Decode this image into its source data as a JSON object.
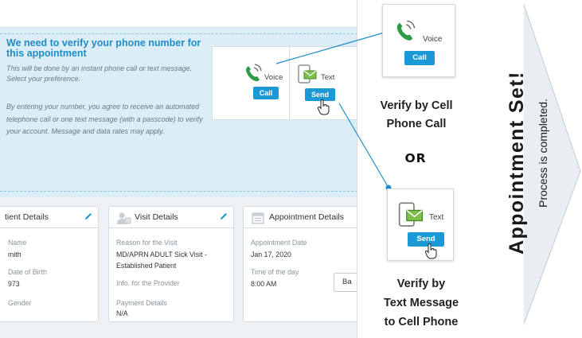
{
  "verify_section": {
    "title": "We need to verify your phone number for this appointment",
    "subtitle": "This will be done by an instant phone call or text message. Select your preference.",
    "legal": "By entering your number, you agree to receive an automated telephone call or one text message (with a passcode) to verify your account. Message and data rates may apply.",
    "voice_label": "Voice",
    "text_label": "Text",
    "call_button": "Call",
    "send_button": "Send"
  },
  "patient_card": {
    "title": "tient Details",
    "name_label": "Name",
    "name_value": "mith",
    "dob_label": "Date of Birth",
    "dob_value": "973",
    "gender_label": "Gender"
  },
  "visit_card": {
    "title": "Visit Details",
    "reason_label": "Reason for the Visit",
    "reason_value_1": "MD/APRN ADULT Sick Visit -",
    "reason_value_2": "Established Patient",
    "info_label": "Info. for the Provider",
    "payment_label": "Payment Details",
    "payment_value": "N/A"
  },
  "appointment_card": {
    "title": "Appointment Details",
    "date_label": "Appointment Date",
    "date_value": "Jan 17, 2020",
    "time_label": "Time of the day",
    "time_value": "8:00 AM",
    "back_button": "Ba"
  },
  "callout_call": {
    "label": "Voice",
    "button": "Call",
    "caption_1": "Verify by Cell",
    "caption_2": "Phone Call"
  },
  "or_text": "OR",
  "callout_text": {
    "label": "Text",
    "button": "Send",
    "caption_1": "Verify by",
    "caption_2": "Text Message",
    "caption_3": "to Cell Phone"
  },
  "arrow": {
    "title": "Appointment Set!",
    "subtitle": "Process is completed."
  },
  "colors": {
    "accent": "#1a99d6",
    "panel_bg": "#dbeef7",
    "title_blue": "#1f8cc7",
    "arrow_fill": "#e9eef2",
    "phone_green": "#2e9b47",
    "connector": "#1f8cc7"
  },
  "icons": [
    "phone-icon",
    "tablet-message-icon",
    "pencil-icon",
    "person-icon",
    "calendar-icon",
    "hand-cursor-icon"
  ]
}
